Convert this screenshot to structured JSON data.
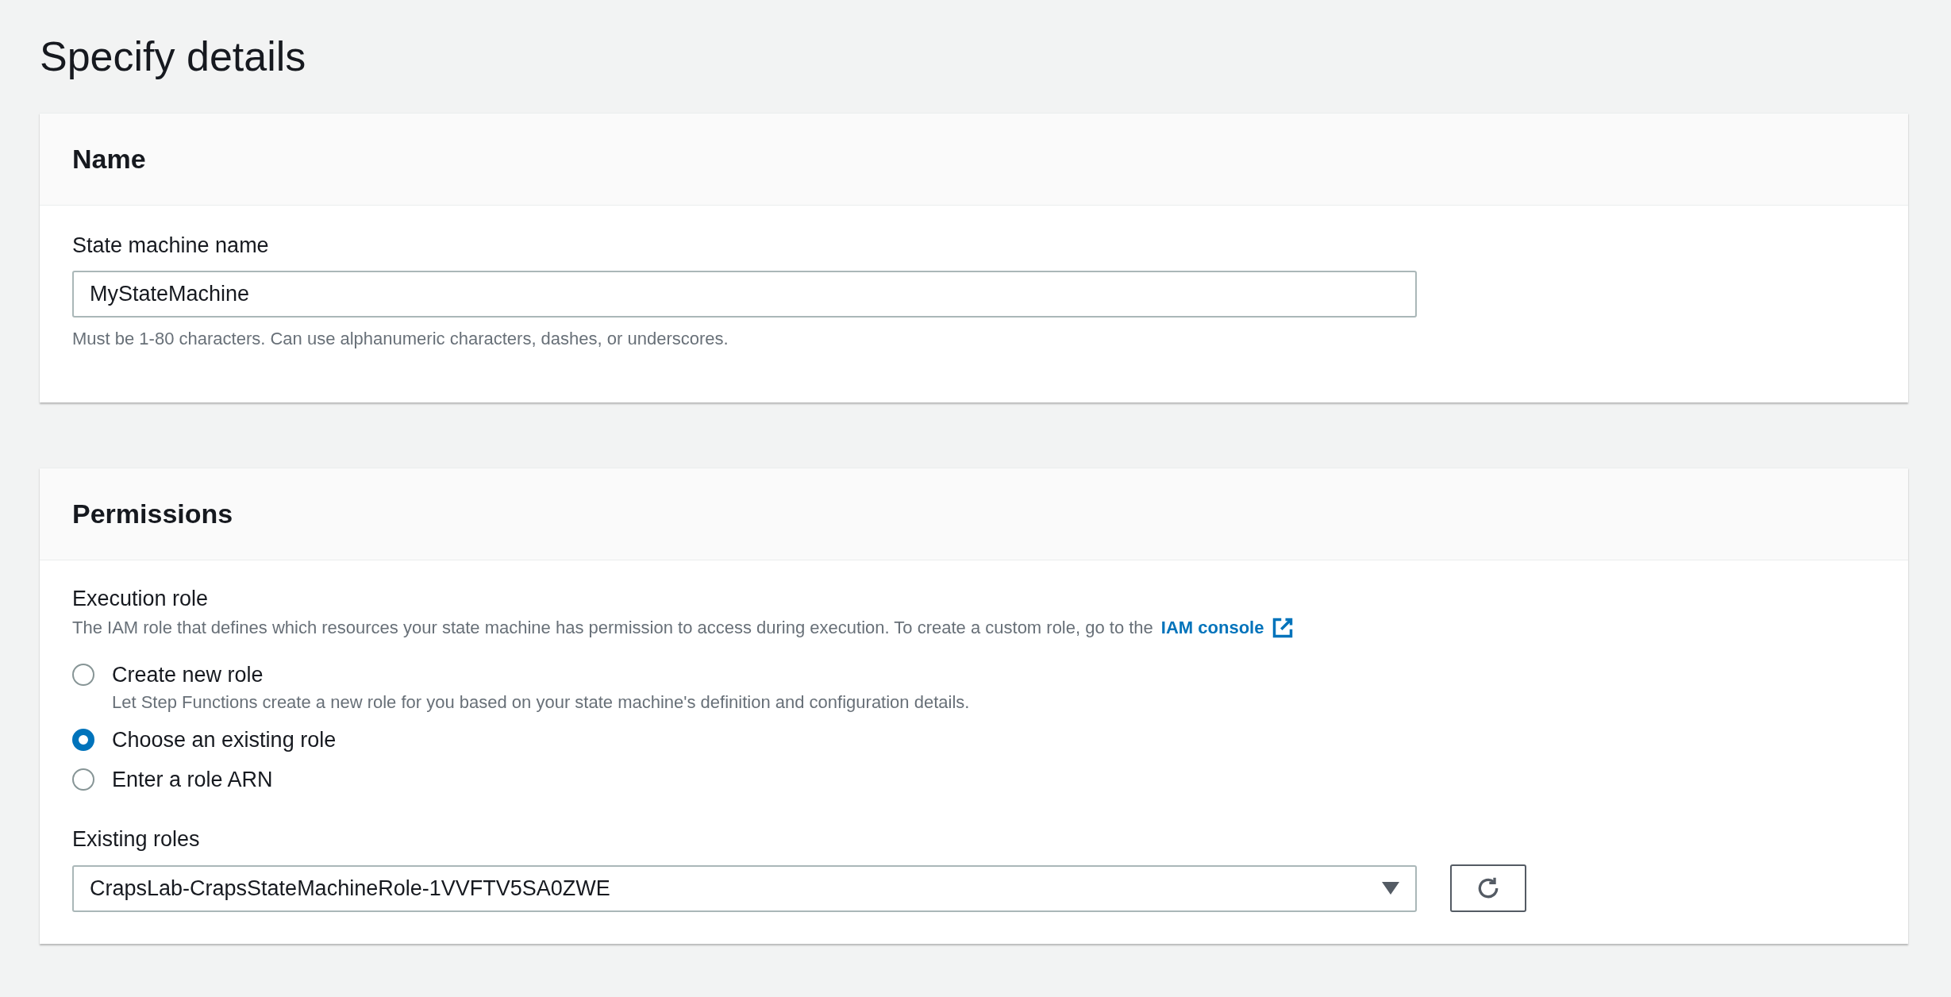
{
  "page_title": "Specify details",
  "name_section": {
    "title": "Name",
    "field": {
      "label": "State machine name",
      "value": "MyStateMachine",
      "hint": "Must be 1-80 characters. Can use alphanumeric characters, dashes, or underscores."
    }
  },
  "permissions_section": {
    "title": "Permissions",
    "execution_role": {
      "label": "Execution role",
      "description": "The IAM role that defines which resources your state machine has permission to access during execution. To create a custom role, go to the",
      "link": "IAM console"
    },
    "options": [
      {
        "label": "Create new role",
        "description": "Let Step Functions create a new role for you based on your state machine's definition and configuration details.",
        "selected": false
      },
      {
        "label": "Choose an existing role",
        "selected": true
      },
      {
        "label": "Enter a role ARN",
        "selected": false
      }
    ],
    "existing_roles": {
      "label": "Existing roles",
      "value": "CrapsLab-CrapsStateMachineRole-1VVFTV5SA0ZWE"
    }
  }
}
